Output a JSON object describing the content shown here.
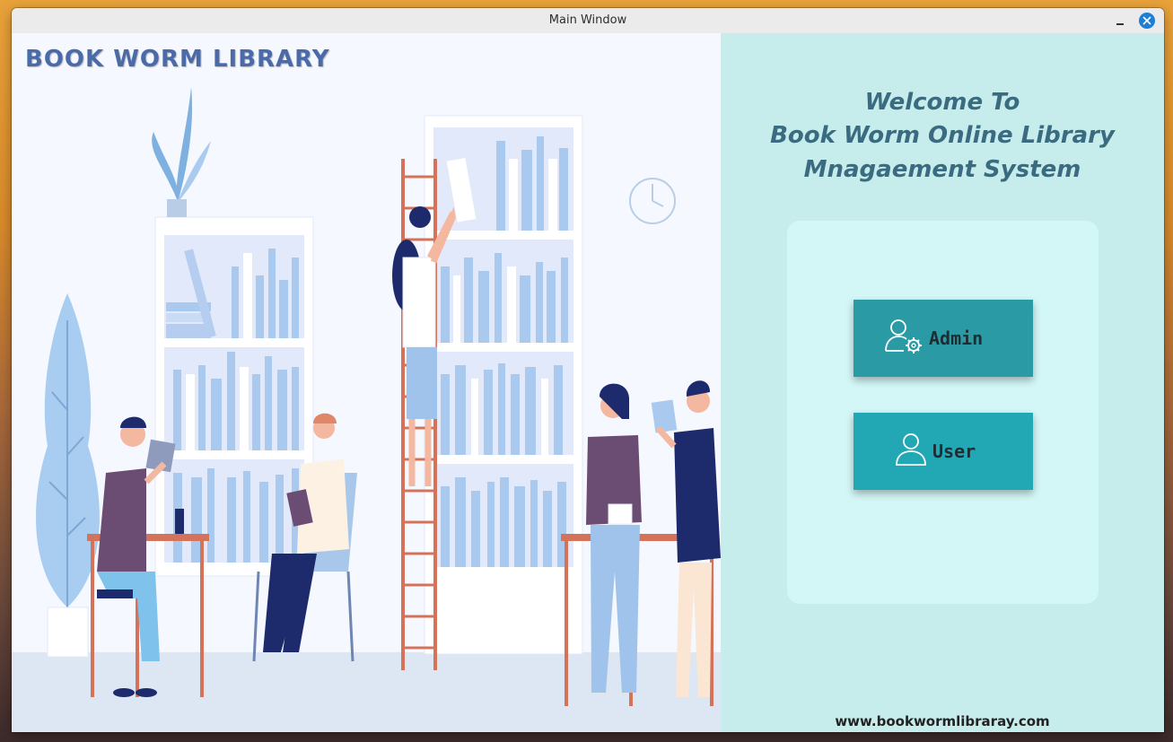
{
  "window": {
    "title": "Main Window"
  },
  "left": {
    "brand": "BOOK WORM LIBRARY"
  },
  "right": {
    "welcome_line1": "Welcome To",
    "welcome_line2": "Book Worm Online Library",
    "welcome_line3": "Mnagaement System",
    "buttons": {
      "admin_label": "Admin",
      "user_label": "User"
    },
    "website": "www.bookwormlibraray.com"
  },
  "colors": {
    "admin_button": "#2a9aa4",
    "user_button": "#22a8b4",
    "right_panel": "#c7ecec",
    "card": "#d3f6f6",
    "brand_text": "#4b6aa8"
  },
  "icons": {
    "admin": "admin-gear-user-icon",
    "user": "user-icon",
    "close": "close-icon",
    "minimize": "minimize-icon"
  }
}
